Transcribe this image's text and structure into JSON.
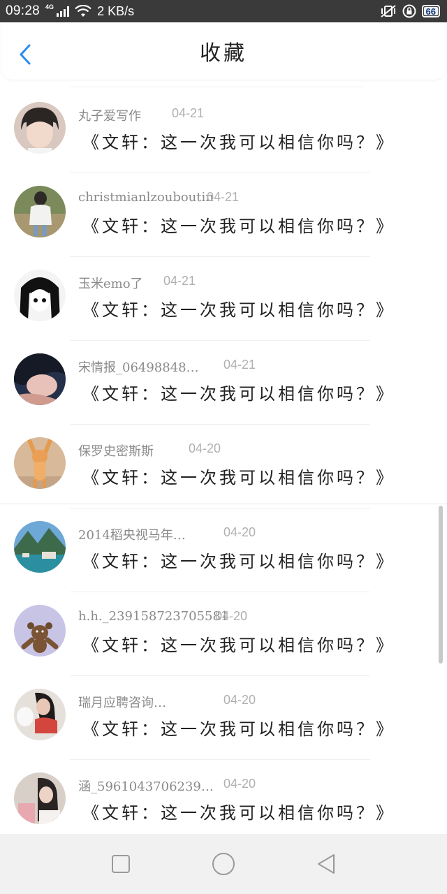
{
  "status_bar": {
    "time": "09:28",
    "network": "4G",
    "speed": "2 KB/s",
    "battery": "66"
  },
  "header": {
    "title": "收藏",
    "back_icon": "chevron-left-icon",
    "accent": "#2a8cf0"
  },
  "favorites": [
    {
      "name": "丸子爱写作",
      "date": "04-21",
      "message": "《文轩：这一次我可以相信你吗？》"
    },
    {
      "name": "christmianlzouboutin",
      "date": "04-21",
      "message": "《文轩：这一次我可以相信你吗？》"
    },
    {
      "name": "玉米emo了",
      "date": "04-21",
      "message": "《文轩：这一次我可以相信你吗？》"
    },
    {
      "name": "宋情报_06498848…",
      "date": "04-21",
      "message": "《文轩：这一次我可以相信你吗？》"
    },
    {
      "name": "保罗史密斯斯",
      "date": "04-20",
      "message": "《文轩：这一次我可以相信你吗？》"
    },
    {
      "name": "2014稻央视马年…",
      "date": "04-20",
      "message": "《文轩：这一次我可以相信你吗？》"
    },
    {
      "name": "h.h._239158723705581",
      "date": "04-20",
      "message": "《文轩：这一次我可以相信你吗？》"
    },
    {
      "name": "瑞月应聘咨询…",
      "date": "04-20",
      "message": "《文轩：这一次我可以相信你吗？》"
    },
    {
      "name": "涵_5961043706239…",
      "date": "04-20",
      "message": "《文轩：这一次我可以相信你吗？》"
    }
  ],
  "navbar": {
    "recent_icon": "square-icon",
    "home_icon": "circle-icon",
    "back_icon": "triangle-back-icon"
  }
}
